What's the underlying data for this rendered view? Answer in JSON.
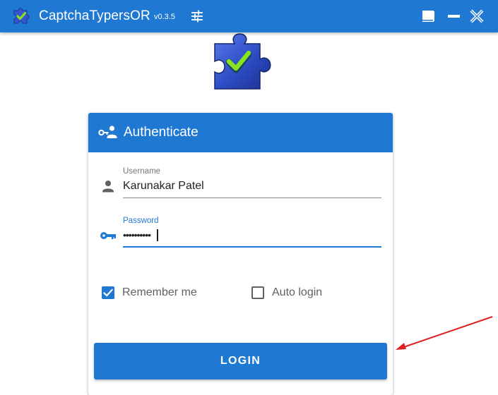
{
  "titlebar": {
    "app_name": "CaptchaTypersOR",
    "version": "v0.3.5",
    "settings_icon": "tune-icon",
    "window_buttons": [
      "restore-icon",
      "minimize-icon",
      "close-icon"
    ]
  },
  "logo": {
    "icon": "puzzle-check-icon"
  },
  "card": {
    "title": "Authenticate",
    "title_icon": "key-person-icon",
    "username": {
      "label": "Username",
      "value": "Karunakar Patel",
      "icon": "person-icon"
    },
    "password": {
      "label": "Password",
      "value": "••••••••••",
      "icon": "key-icon"
    },
    "remember_me": {
      "label": "Remember me",
      "checked": true
    },
    "auto_login": {
      "label": "Auto login",
      "checked": false
    },
    "login_button": "LOGIN"
  },
  "colors": {
    "primary": "#1f78d1",
    "annotation_arrow": "#e02020",
    "puzzle_blue": "#2a4fc4",
    "check_green": "#7ee01e"
  }
}
